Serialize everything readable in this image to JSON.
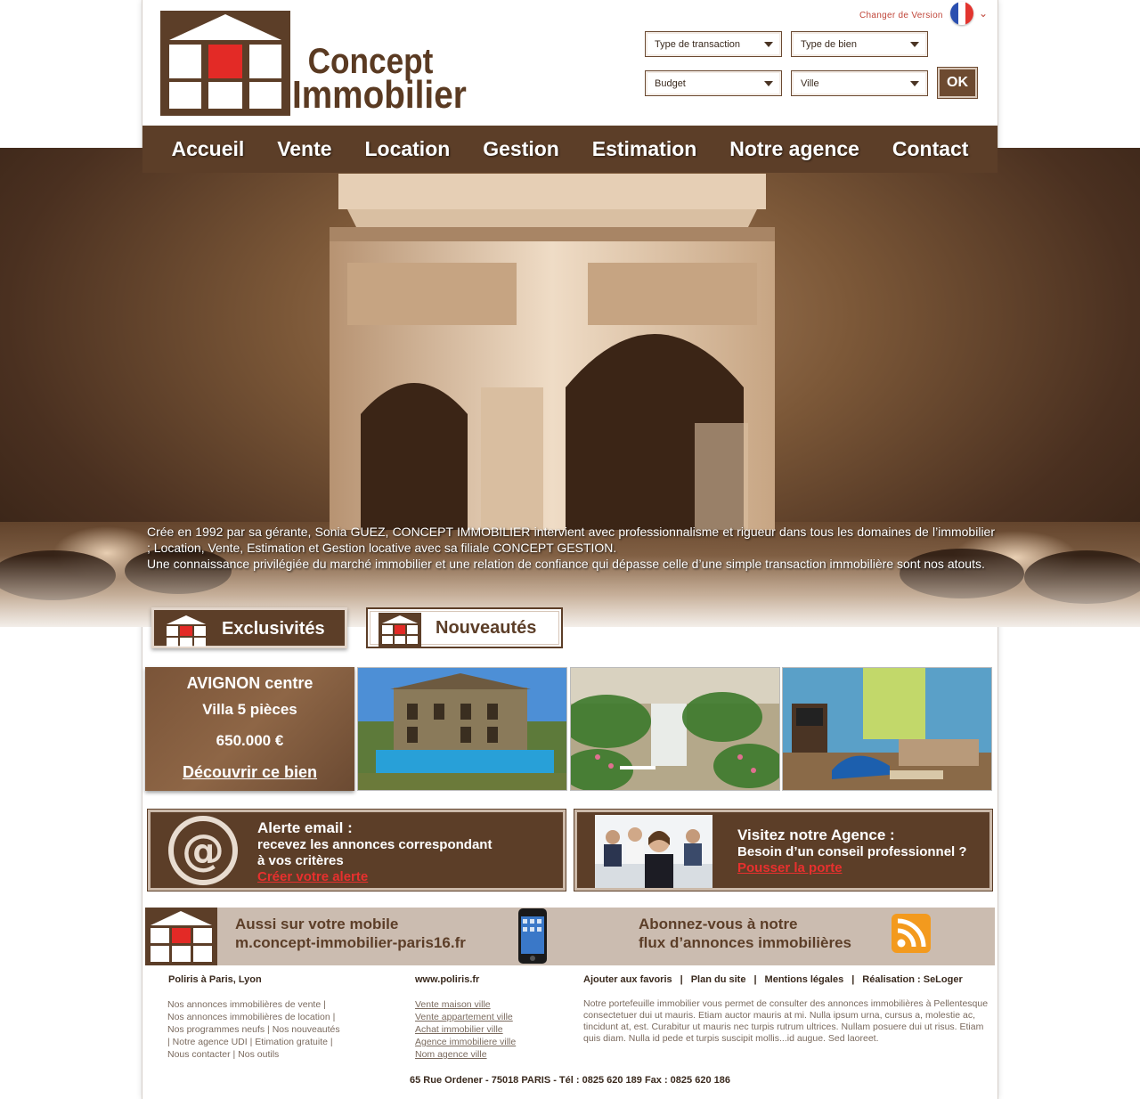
{
  "logo": {
    "line1": "Concept",
    "line2": "Immobilier"
  },
  "header": {
    "change_version": "Changer de Version",
    "selects": {
      "transaction": "Type de transaction",
      "bien": "Type de bien",
      "budget": "Budget",
      "ville": "Ville"
    },
    "ok": "OK"
  },
  "nav": [
    "Accueil",
    "Vente",
    "Location",
    "Gestion",
    "Estimation",
    "Notre agence",
    "Contact"
  ],
  "hero": {
    "p1": "Crée en 1992 par sa gérante, Sonia GUEZ, CONCEPT IMMOBILIER intervient avec professionnalisme et rigueur dans tous les domaines de l’immobilier ; Location, Vente, Estimation et Gestion locative avec sa filiale CONCEPT GESTION.",
    "p2": "Une connaissance privilégiée du marché immobilier et une relation de confiance qui dépasse celle d’une simple transaction immobilière sont nos atouts."
  },
  "tabs": {
    "exclusivites": "Exclusivités",
    "nouveautes": "Nouveautés"
  },
  "property": {
    "city": "AVIGNON centre",
    "type": "Villa 5 pièces",
    "price": "650.000 €",
    "cta": "Découvrir ce bien"
  },
  "alert_box": {
    "title": "Alerte email :",
    "line1": "recevez les annonces correspondant",
    "line2": "à vos critères",
    "link": "Créer votre alerte"
  },
  "agency_box": {
    "title": "Visitez notre Agence :",
    "line1": "Besoin d’un conseil professionnel ?",
    "link": "Pousser la porte"
  },
  "mobile": {
    "line1": "Aussi sur votre  mobile",
    "line2": "m.concept-immobilier-paris16.fr",
    "rss1": "Abonnez-vous à notre",
    "rss2": "flux d’annonces immobilières"
  },
  "footer": {
    "col1_title": "Poliris à Paris, Lyon",
    "col1_lines": [
      "Nos annonces immobilières de vente |",
      "Nos annonces immobilières de location |",
      "Nos programmes neufs | Nos nouveautés",
      "| Notre agence UDI | Etimation gratuite |",
      "Nous contacter | Nos outils"
    ],
    "col2_title": "www.poliris.fr",
    "col2_links": [
      "Vente maison ville",
      "Vente appartement ville",
      "Achat immobilier ville",
      "Agence immobiliere ville",
      "Nom agence ville"
    ],
    "bar": [
      "Ajouter aux favoris",
      "Plan du site",
      "Mentions légales",
      "Réalisation : SeLoger"
    ],
    "desc": "Notre portefeuille immobilier vous permet de consulter des annonces immobilières à Pellentesque consectetuer dui ut mauris. Etiam auctor mauris at mi. Nulla ipsum urna, cursus a, molestie ac, tincidunt at, est. Curabitur ut mauris nec turpis rutrum ultrices. Nullam posuere dui ut risus. Etiam quis diam. Nulla id pede et turpis suscipit mollis...id augue. Sed laoreet.",
    "address": "65 Rue Ordener - 75018 PARIS  -  Tél : 0825 620 189  Fax : 0825 620 186"
  },
  "colors": {
    "brown": "#5c3e28",
    "accent_red": "#e8302e",
    "light_beige": "#cbbcb0"
  }
}
